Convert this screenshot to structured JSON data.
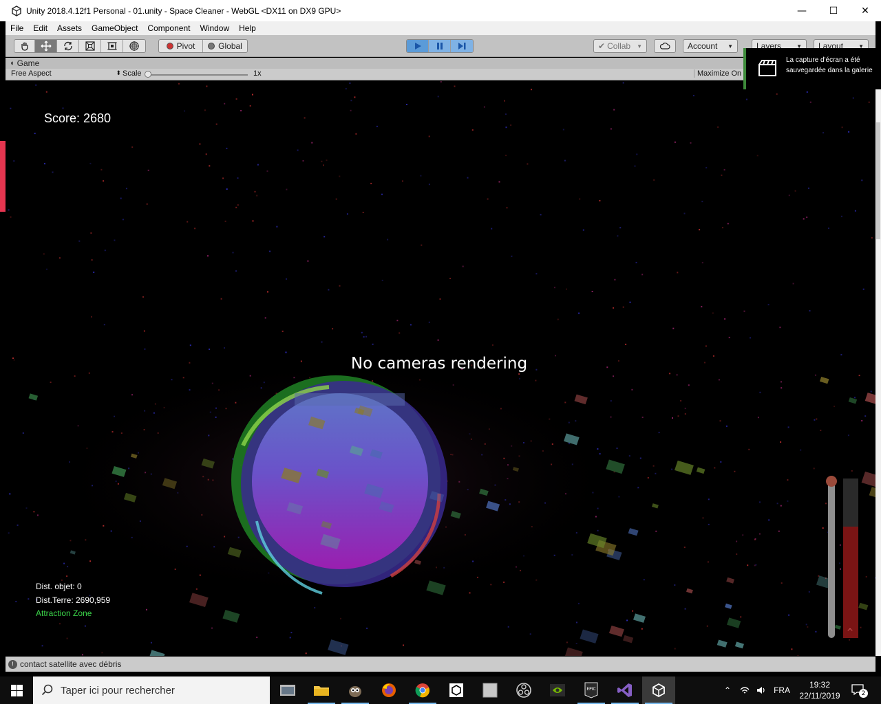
{
  "window": {
    "title": "Unity 2018.4.12f1 Personal - 01.unity - Space Cleaner - WebGL <DX11 on DX9 GPU>",
    "min_glyph": "—",
    "max_glyph": "☐",
    "close_glyph": "✕"
  },
  "menu": [
    "File",
    "Edit",
    "Assets",
    "GameObject",
    "Component",
    "Window",
    "Help"
  ],
  "toolbar": {
    "pivot_label": "Pivot",
    "global_label": "Global",
    "collab_label": "Collab",
    "account_label": "Account",
    "layers_label": "Layers",
    "layout_label": "Layout"
  },
  "game_tab": {
    "label": "Game",
    "aspect": "Free Aspect",
    "scale_label": "Scale",
    "scale_value": "1x",
    "maximize_label": "Maximize On"
  },
  "game_view": {
    "score": "Score: 2680",
    "message": "No cameras rendering",
    "dist_objet": "Dist. objet: 0",
    "dist_terre": "Dist.Terre: 2690,959",
    "attraction": "Attraction Zone",
    "gauge_level": 0.7
  },
  "status": {
    "message": "contact satellite avec débris"
  },
  "toast": {
    "text": "La capture d'écran a été sauvegardée dans la galerie"
  },
  "taskbar": {
    "search_placeholder": "Taper ici pour rechercher",
    "language": "FRA",
    "time": "19:32",
    "date": "22/11/2019",
    "notifications": "2"
  },
  "colors": {
    "play_active": "#5b9bd8",
    "attraction_text": "#3bd64a",
    "toast_accent": "#3d8a3a"
  }
}
